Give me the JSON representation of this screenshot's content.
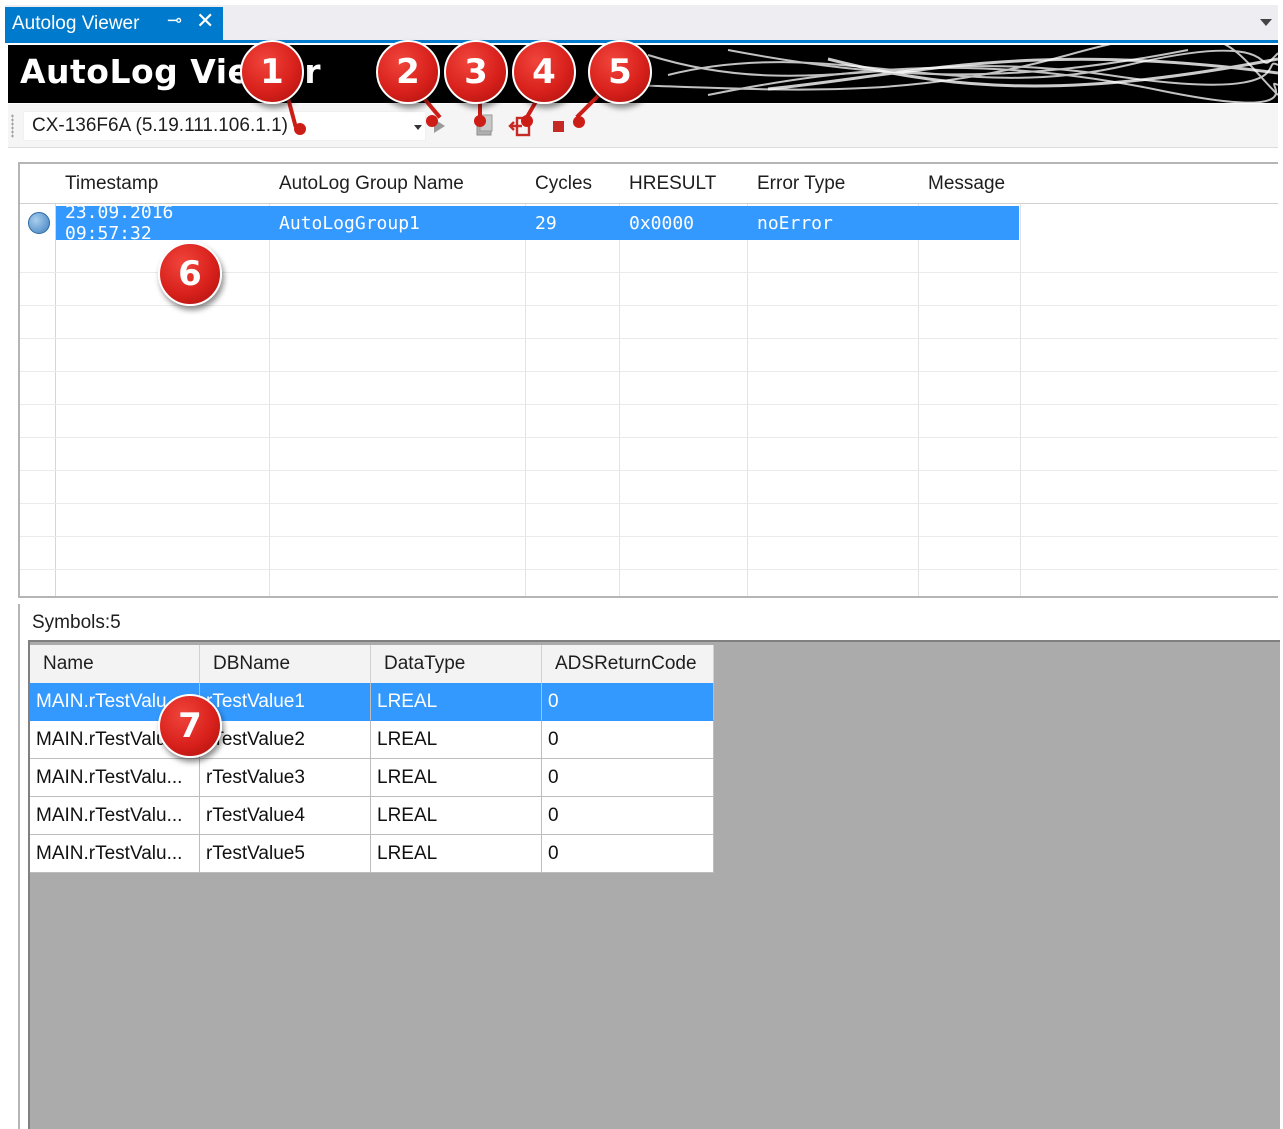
{
  "window": {
    "tab_title": "Autolog Viewer",
    "pin_icon": "pin-icon",
    "close_icon": "close-icon"
  },
  "banner": {
    "title": "AutoLog Viewer"
  },
  "toolbar": {
    "target_value": "CX-136F6A (5.19.111.106.1.1)",
    "buttons": [
      "play-icon",
      "export-icon",
      "logout-icon",
      "stop-icon"
    ]
  },
  "events": {
    "columns": [
      "Timestamp",
      "AutoLog Group Name",
      "Cycles",
      "HRESULT",
      "Error Type",
      "Message"
    ],
    "rows": [
      {
        "timestamp": "23.09.2016 09:57:32",
        "group": "AutoLogGroup1",
        "cycles": "29",
        "hresult": "0x0000",
        "error_type": "noError",
        "message": ""
      }
    ]
  },
  "symbols": {
    "label": "Symbols:5",
    "columns": [
      "Name",
      "DBName",
      "DataType",
      "ADSReturnCode"
    ],
    "rows": [
      {
        "name": "MAIN.rTestValu...",
        "dbname": "rTestValue1",
        "datatype": "LREAL",
        "code": "0"
      },
      {
        "name": "MAIN.rTestValu...",
        "dbname": "rTestValue2",
        "datatype": "LREAL",
        "code": "0"
      },
      {
        "name": "MAIN.rTestValu...",
        "dbname": "rTestValue3",
        "datatype": "LREAL",
        "code": "0"
      },
      {
        "name": "MAIN.rTestValu...",
        "dbname": "rTestValue4",
        "datatype": "LREAL",
        "code": "0"
      },
      {
        "name": "MAIN.rTestValu...",
        "dbname": "rTestValue5",
        "datatype": "LREAL",
        "code": "0"
      }
    ]
  },
  "callouts": [
    "1",
    "2",
    "3",
    "4",
    "5",
    "6",
    "7"
  ],
  "colors": {
    "accent": "#007acc",
    "selection": "#3399ff",
    "callout": "#d9211c"
  }
}
